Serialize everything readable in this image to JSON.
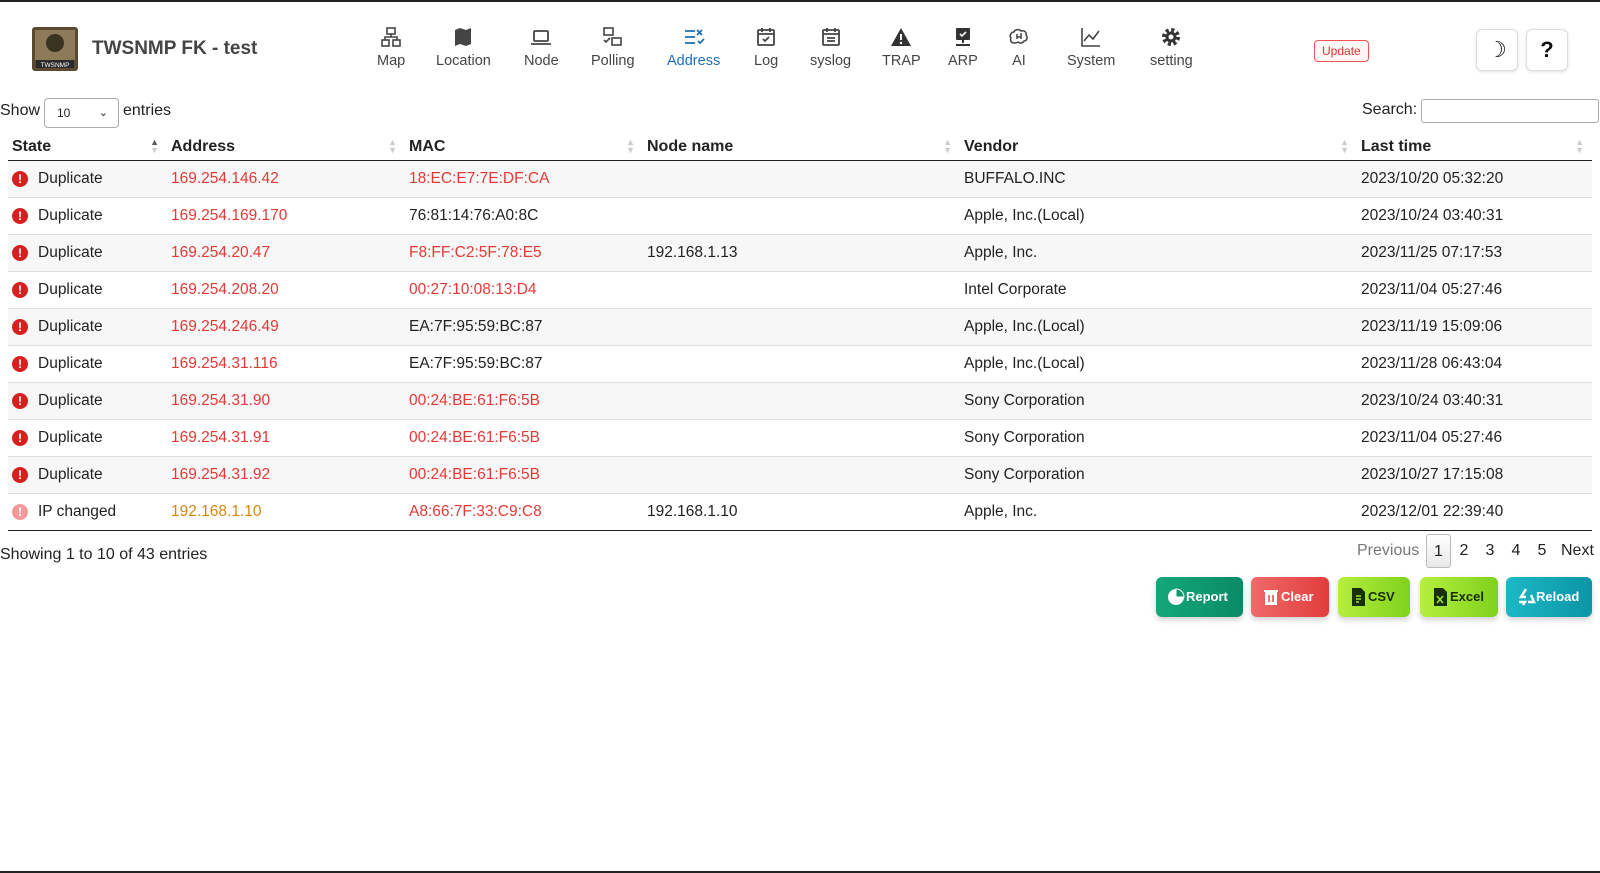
{
  "app": {
    "title": "TWSNMP FK - test",
    "logo_text": "TWSNMP"
  },
  "nav": [
    {
      "label": "Map",
      "icon": "network-icon"
    },
    {
      "label": "Location",
      "icon": "map-icon"
    },
    {
      "label": "Node",
      "icon": "laptop-icon"
    },
    {
      "label": "Polling",
      "icon": "polling-icon"
    },
    {
      "label": "Address",
      "icon": "address-list-icon",
      "active": true
    },
    {
      "label": "Log",
      "icon": "calendar-check-icon"
    },
    {
      "label": "syslog",
      "icon": "calendar-icon"
    },
    {
      "label": "TRAP",
      "icon": "warning-icon"
    },
    {
      "label": "ARP",
      "icon": "arp-icon"
    },
    {
      "label": "AI",
      "icon": "brain-icon"
    },
    {
      "label": "System",
      "icon": "chart-line-icon"
    },
    {
      "label": "setting",
      "icon": "gear-icon"
    }
  ],
  "header": {
    "update_label": "Update",
    "theme_glyph": "☽",
    "help_glyph": "?"
  },
  "controls": {
    "show_label": "Show",
    "page_size": "10",
    "entries_label": "entries",
    "search_label": "Search:",
    "search_value": ""
  },
  "table": {
    "columns": [
      "State",
      "Address",
      "MAC",
      "Node name",
      "Vendor",
      "Last time"
    ],
    "rows": [
      {
        "state": "Duplicate",
        "level": "high",
        "address": "169.254.146.42",
        "address_color": "red",
        "mac": "18:EC:E7:7E:DF:CA",
        "mac_color": "red",
        "node": "",
        "vendor": "BUFFALO.INC",
        "time": "2023/10/20 05:32:20"
      },
      {
        "state": "Duplicate",
        "level": "high",
        "address": "169.254.169.170",
        "address_color": "red",
        "mac": "76:81:14:76:A0:8C",
        "mac_color": "black",
        "node": "",
        "vendor": "Apple, Inc.(Local)",
        "time": "2023/10/24 03:40:31"
      },
      {
        "state": "Duplicate",
        "level": "high",
        "address": "169.254.20.47",
        "address_color": "red",
        "mac": "F8:FF:C2:5F:78:E5",
        "mac_color": "red",
        "node": "192.168.1.13",
        "vendor": "Apple, Inc.",
        "time": "2023/11/25 07:17:53"
      },
      {
        "state": "Duplicate",
        "level": "high",
        "address": "169.254.208.20",
        "address_color": "red",
        "mac": "00:27:10:08:13:D4",
        "mac_color": "red",
        "node": "",
        "vendor": "Intel Corporate",
        "time": "2023/11/04 05:27:46"
      },
      {
        "state": "Duplicate",
        "level": "high",
        "address": "169.254.246.49",
        "address_color": "red",
        "mac": "EA:7F:95:59:BC:87",
        "mac_color": "black",
        "node": "",
        "vendor": "Apple, Inc.(Local)",
        "time": "2023/11/19 15:09:06"
      },
      {
        "state": "Duplicate",
        "level": "high",
        "address": "169.254.31.116",
        "address_color": "red",
        "mac": "EA:7F:95:59:BC:87",
        "mac_color": "black",
        "node": "",
        "vendor": "Apple, Inc.(Local)",
        "time": "2023/11/28 06:43:04"
      },
      {
        "state": "Duplicate",
        "level": "high",
        "address": "169.254.31.90",
        "address_color": "red",
        "mac": "00:24:BE:61:F6:5B",
        "mac_color": "red",
        "node": "",
        "vendor": "Sony Corporation",
        "time": "2023/10/24 03:40:31"
      },
      {
        "state": "Duplicate",
        "level": "high",
        "address": "169.254.31.91",
        "address_color": "red",
        "mac": "00:24:BE:61:F6:5B",
        "mac_color": "red",
        "node": "",
        "vendor": "Sony Corporation",
        "time": "2023/11/04 05:27:46"
      },
      {
        "state": "Duplicate",
        "level": "high",
        "address": "169.254.31.92",
        "address_color": "red",
        "mac": "00:24:BE:61:F6:5B",
        "mac_color": "red",
        "node": "",
        "vendor": "Sony Corporation",
        "time": "2023/10/27 17:15:08"
      },
      {
        "state": "IP changed",
        "level": "low",
        "address": "192.168.1.10",
        "address_color": "orange",
        "mac": "A8:66:7F:33:C9:C8",
        "mac_color": "red",
        "node": "192.168.1.10",
        "vendor": "Apple, Inc.",
        "time": "2023/12/01 22:39:40"
      }
    ]
  },
  "footer": {
    "info": "Showing 1 to 10 of 43 entries",
    "previous": "Previous",
    "pages": [
      "1",
      "2",
      "3",
      "4",
      "5"
    ],
    "next": "Next"
  },
  "actions": [
    {
      "label": "Report",
      "icon": "pie-chart-icon",
      "color": "#0f9a6e"
    },
    {
      "label": "Clear",
      "icon": "trash-icon",
      "color": "#ea4f4f"
    },
    {
      "label": "CSV",
      "icon": "csv-file-icon",
      "color": "#8ed62a"
    },
    {
      "label": "Excel",
      "icon": "excel-file-icon",
      "color": "#8ed62a"
    },
    {
      "label": "Reload",
      "icon": "recycle-icon",
      "color": "#10a4b4"
    }
  ],
  "colors": {
    "red": "#e53935",
    "orange": "#d4880f",
    "accent": "#1e6fb8",
    "state_high": "#d62020",
    "state_low": "#f29a9a"
  }
}
